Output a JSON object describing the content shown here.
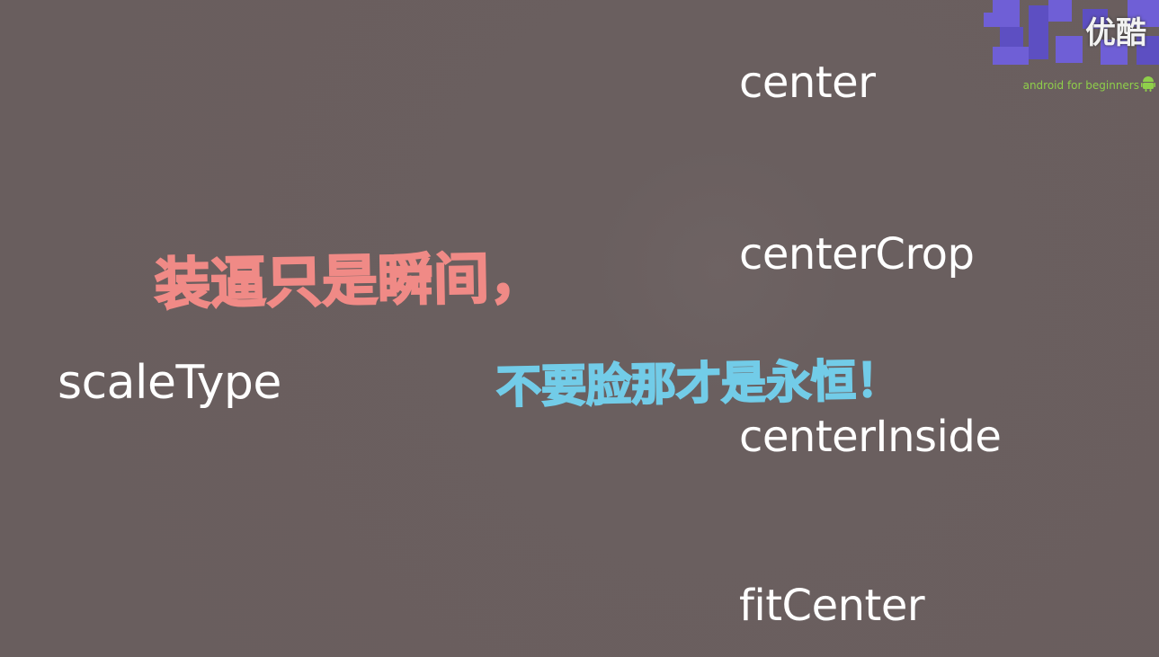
{
  "main_label": "scaleType",
  "options": [
    "center",
    "centerCrop",
    "centerInside",
    "fitCenter"
  ],
  "captions": {
    "line1": "装逼只是瞬间，",
    "line2": "不要脸那才是永恒！"
  },
  "watermark": {
    "site": "优酷",
    "tagline": "android for beginners",
    "icon": "android-robot-icon"
  },
  "colors": {
    "background": "#6a5f5f",
    "text": "#ffffff",
    "caption_pink": "#f08a86",
    "caption_blue": "#72cce8",
    "watermark_blocks": "#6f5fd6",
    "tagline_green": "#8fcf4a"
  }
}
